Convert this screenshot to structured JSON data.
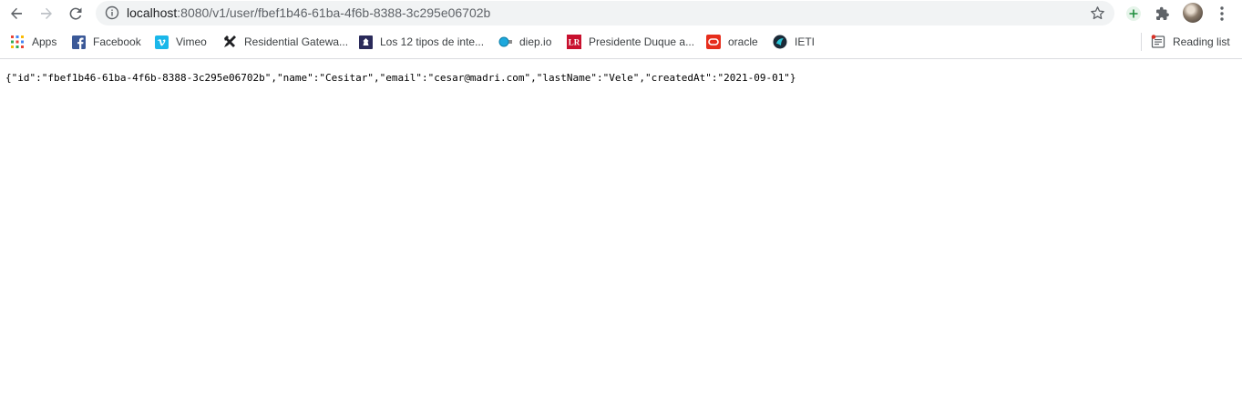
{
  "browser": {
    "url_host": "localhost",
    "url_rest": ":8080/v1/user/fbef1b46-61ba-4f6b-8388-3c295e06702b",
    "icons": [
      "back-icon",
      "forward-icon",
      "reload-icon",
      "info-icon",
      "star-icon",
      "add-icon",
      "extensions-icon",
      "menu-icon"
    ]
  },
  "bookmarks": {
    "items": [
      {
        "label": "Apps",
        "icon": "apps-grid-icon"
      },
      {
        "label": "Facebook",
        "icon": "facebook-icon"
      },
      {
        "label": "Vimeo",
        "icon": "vimeo-icon"
      },
      {
        "label": "Residential Gatewa...",
        "icon": "tools-icon"
      },
      {
        "label": "Los 12 tipos de inte...",
        "icon": "site-icon"
      },
      {
        "label": "diep.io",
        "icon": "diep-icon"
      },
      {
        "label": "Presidente Duque a...",
        "icon": "lr-icon"
      },
      {
        "label": "oracle",
        "icon": "oracle-icon"
      },
      {
        "label": "IETI",
        "icon": "ieti-icon"
      }
    ],
    "reading_list": "Reading list"
  },
  "page": {
    "json_text": "{\"id\":\"fbef1b46-61ba-4f6b-8388-3c295e06702b\",\"name\":\"Cesitar\",\"email\":\"cesar@madri.com\",\"lastName\":\"Vele\",\"createdAt\":\"2021-09-01\"}"
  },
  "colors": {
    "accent_green": "#1e8e3e",
    "facebook": "#3b5998",
    "vimeo": "#1ab7ea",
    "lr_red": "#c8102e",
    "oracle_red": "#e62d1c"
  }
}
